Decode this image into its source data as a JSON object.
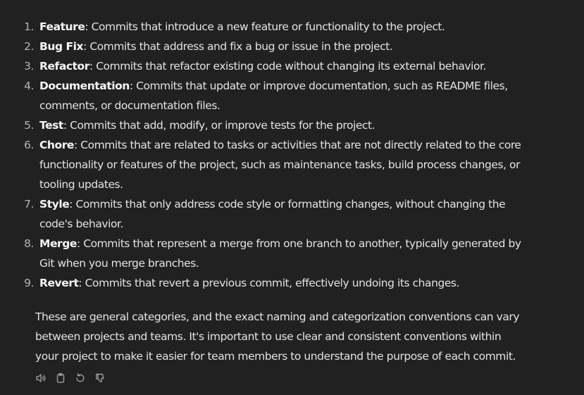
{
  "list": [
    {
      "num": "1.",
      "term": "Feature",
      "desc": ": Commits that introduce a new feature or functionality to the project."
    },
    {
      "num": "2.",
      "term": "Bug Fix",
      "desc": ": Commits that address and fix a bug or issue in the project."
    },
    {
      "num": "3.",
      "term": "Refactor",
      "desc": ": Commits that refactor existing code without changing its external behavior."
    },
    {
      "num": "4.",
      "term": "Documentation",
      "desc": ": Commits that update or improve documentation, such as README files, comments, or documentation files."
    },
    {
      "num": "5.",
      "term": "Test",
      "desc": ": Commits that add, modify, or improve tests for the project."
    },
    {
      "num": "6.",
      "term": "Chore",
      "desc": ": Commits that are related to tasks or activities that are not directly related to the core functionality or features of the project, such as maintenance tasks, build process changes, or tooling updates."
    },
    {
      "num": "7.",
      "term": "Style",
      "desc": ": Commits that only address code style or formatting changes, without changing the code's behavior."
    },
    {
      "num": "8.",
      "term": "Merge",
      "desc": ": Commits that represent a merge from one branch to another, typically generated by Git when you merge branches."
    },
    {
      "num": "9.",
      "term": "Revert",
      "desc": ": Commits that revert a previous commit, effectively undoing its changes."
    }
  ],
  "summary": "These are general categories, and the exact naming and categorization conventions can vary between projects and teams. It's important to use clear and consistent conventions within your project to make it easier for team members to understand the purpose of each commit.",
  "actions": {
    "icons": [
      "speaker-icon",
      "clipboard-icon",
      "regenerate-icon",
      "thumbs-down-icon"
    ],
    "icon_color": "#9b9b9b"
  }
}
